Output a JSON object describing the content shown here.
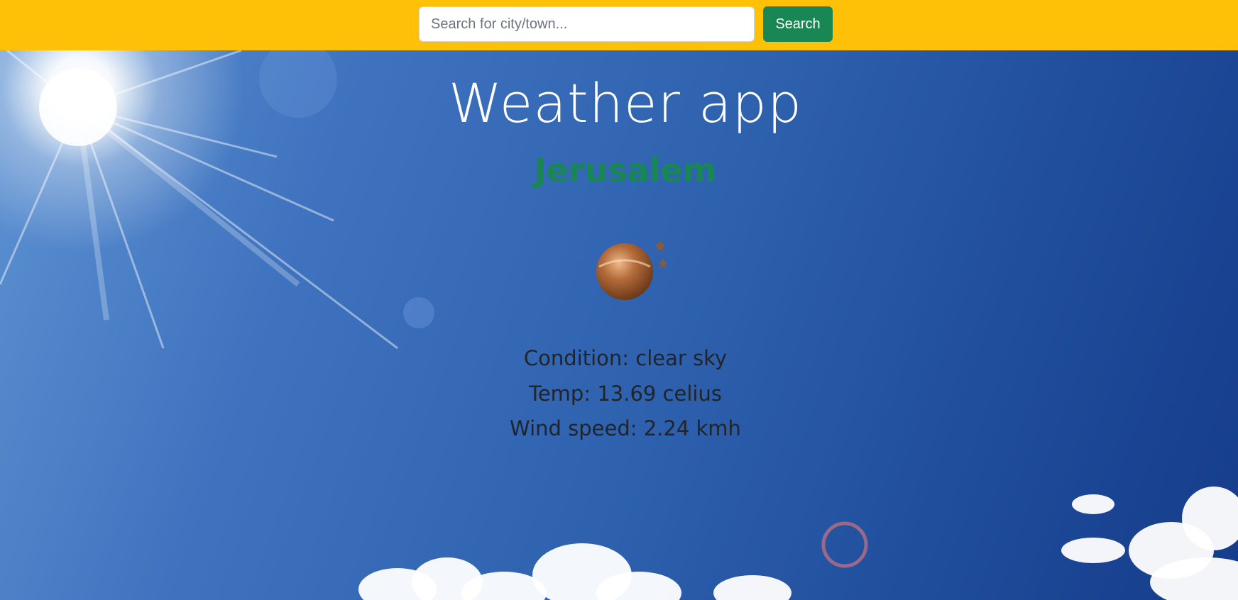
{
  "search": {
    "placeholder": "Search for city/town...",
    "button_label": "Search"
  },
  "main": {
    "title": "Weather app",
    "city": "Jerusalem",
    "weather_icon": "clear-night-icon",
    "condition_text": "Condition: clear sky",
    "temp_text": "Temp: 13.69 celius",
    "wind_text": "Wind speed: 2.24 kmh"
  },
  "colors": {
    "topbar": "#ffc107",
    "search_button": "#198754",
    "city": "#198754",
    "title": "#ffffff",
    "info_text": "#212529",
    "sky": "#2f63b0"
  }
}
